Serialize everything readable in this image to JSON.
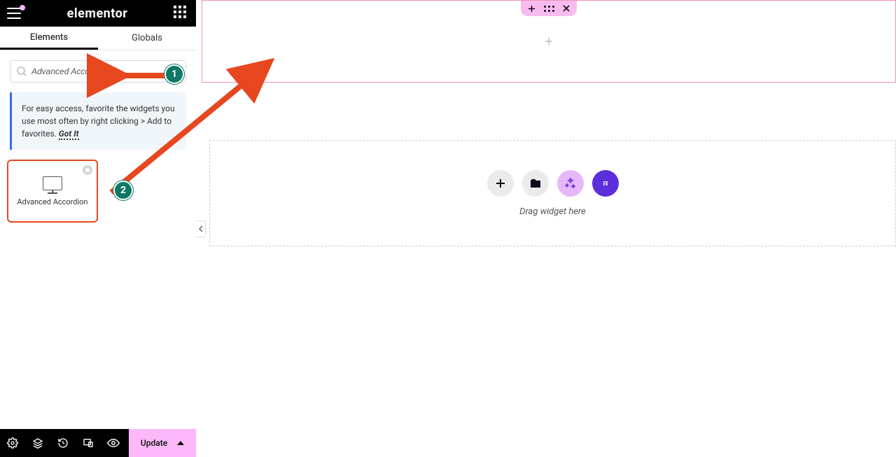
{
  "brand": "elementor",
  "tabs": {
    "elements": "Elements",
    "globals": "Globals"
  },
  "search": {
    "value": "Advanced Accordion"
  },
  "tip": {
    "text": "For easy access, favorite the widgets you use most often by right clicking > Add to favorites.",
    "gotit": "Got It"
  },
  "widget": {
    "label": "Advanced Accordion"
  },
  "bottombar": {
    "update": "Update"
  },
  "canvas": {
    "drop_text": "Drag widget here"
  },
  "annotations": {
    "step1": "1",
    "step2": "2"
  }
}
